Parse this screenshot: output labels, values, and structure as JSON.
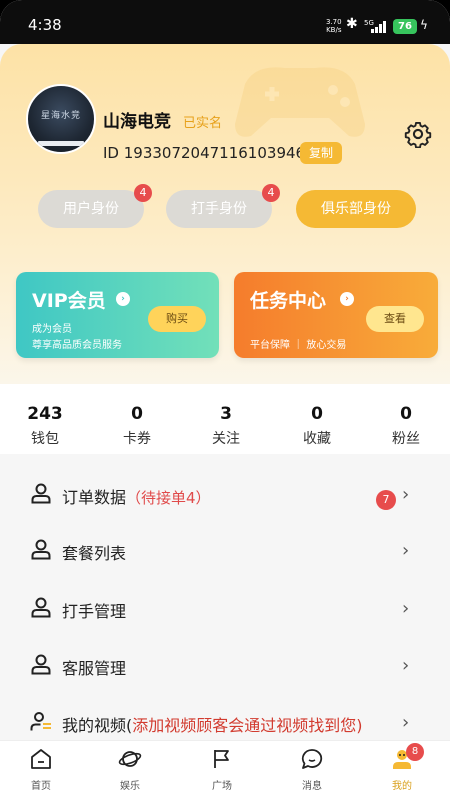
{
  "status_bar": {
    "time": "4:38",
    "net_speed_value": "3.70",
    "net_speed_unit": "KB/s",
    "network": "5G",
    "battery": "76",
    "bluetooth_icon": "bluetooth-icon",
    "charging_icon": "bolt-icon"
  },
  "profile": {
    "name": "山海电竞",
    "verified": "已实名",
    "id": "ID 1933072047116103946",
    "copy_label": "复制",
    "settings_icon": "gear-icon"
  },
  "roles": [
    {
      "label": "用户身份",
      "badge": "4"
    },
    {
      "label": "打手身份",
      "badge": "4"
    },
    {
      "label": "俱乐部身份"
    }
  ],
  "cards": {
    "vip": {
      "title": "VIP会员",
      "line1": "成为会员",
      "line2": "尊享高品质会员服务",
      "button": "购买"
    },
    "task": {
      "title": "任务中心",
      "line1": "平台保障 ｜ 放心交易",
      "button": "查看"
    }
  },
  "stats": [
    {
      "value": "243",
      "label": "钱包"
    },
    {
      "value": "0",
      "label": "卡券"
    },
    {
      "value": "3",
      "label": "关注"
    },
    {
      "value": "0",
      "label": "收藏"
    },
    {
      "value": "0",
      "label": "粉丝"
    }
  ],
  "menu": [
    {
      "label": "订单数据",
      "note": "（待接单4）",
      "badge": "7"
    },
    {
      "label": "套餐列表"
    },
    {
      "label": "打手管理"
    },
    {
      "label": "客服管理"
    },
    {
      "label": "我的视频(",
      "note": "添加视频顾客会通过视频找到您)"
    }
  ],
  "nav": [
    {
      "label": "首页",
      "icon": "home-icon"
    },
    {
      "label": "娱乐",
      "icon": "planet-icon"
    },
    {
      "label": "广场",
      "icon": "flag-icon"
    },
    {
      "label": "消息",
      "icon": "chat-icon"
    },
    {
      "label": "我的",
      "icon": "profile-icon",
      "badge": "8"
    }
  ],
  "colors": {
    "accent": "#f5b934",
    "badge": "#e74c4c",
    "vip": "#3fc7c4",
    "task": "#f57c2c"
  }
}
